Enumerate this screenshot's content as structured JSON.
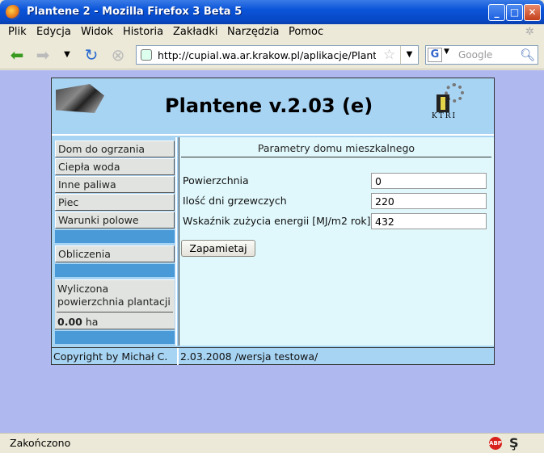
{
  "window": {
    "title": "Plantene 2 - Mozilla Firefox 3 Beta 5",
    "minimize": "_",
    "maximize": "□",
    "close": "✕"
  },
  "menubar": {
    "items": [
      "Plik",
      "Edycja",
      "Widok",
      "Historia",
      "Zakładki",
      "Narzędzia",
      "Pomoc"
    ]
  },
  "navbar": {
    "url": "http://cupial.wa.ar.krakow.pl/aplikacje/Plant",
    "search_placeholder": "Google",
    "search_engine_letter": "G"
  },
  "app": {
    "title": "Plantene v.2.03 (e)",
    "logo_right_text": "KTRI",
    "sidebar": {
      "items": [
        "Dom do ogrzania",
        "Ciepła woda",
        "Inne paliwa",
        "Piec",
        "Warunki polowe"
      ],
      "calc_item": "Obliczenia",
      "result_label": "Wyliczona powierzchnia plantacji",
      "result_value": "0.00",
      "result_unit": "ha"
    },
    "main": {
      "section_title": "Parametry domu mieszkalnego",
      "fields": [
        {
          "label": "Powierzchnia",
          "value": "0"
        },
        {
          "label": "Ilość dni grzewczych",
          "value": "220"
        },
        {
          "label": "Wskaźnik zużycia energii [MJ/m2 rok]",
          "value": "432"
        }
      ],
      "save_label": "Zapamietaj"
    },
    "footer": {
      "copyright": "Copyright by Michał C.",
      "version": "2.03.2008 /wersja testowa/"
    }
  },
  "statusbar": {
    "status": "Zakończono",
    "abp_label": "ABP"
  }
}
